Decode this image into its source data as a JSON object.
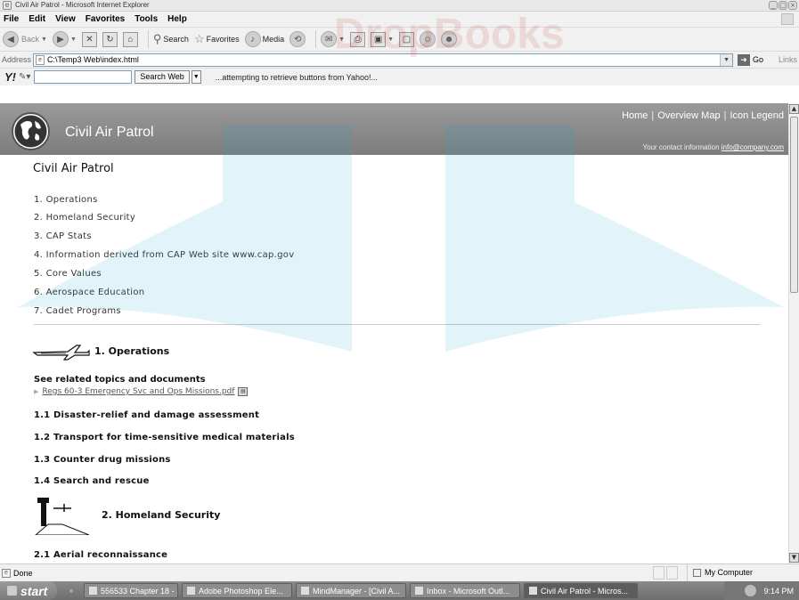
{
  "browser": {
    "window_title": "Civil Air Patrol - Microsoft Internet Explorer",
    "menu": [
      "File",
      "Edit",
      "View",
      "Favorites",
      "Tools",
      "Help"
    ],
    "toolbar": {
      "back": "Back",
      "search": "Search",
      "favorites": "Favorites",
      "media": "Media"
    },
    "address_label": "Address",
    "address_value": "C:\\Temp3 Web\\index.html",
    "go_label": "Go",
    "links_label": "Links",
    "yahoo": {
      "search_button": "Search Web",
      "message": "...attempting to retrieve buttons from Yahoo!..."
    },
    "status": {
      "text": "Done",
      "zone": "My Computer"
    }
  },
  "site": {
    "name": "Civil Air Patrol",
    "top_links": [
      "Home",
      "Overview Map",
      "Icon Legend"
    ],
    "link_separator": "|",
    "contact_label": "Your contact information",
    "contact_email": "info@company.com"
  },
  "page": {
    "title": "Civil Air Patrol",
    "toc": [
      "1. Operations",
      "2. Homeland Security",
      "3. CAP Stats",
      "4. Information derived from CAP Web site www.cap.gov",
      "5. Core Values",
      "6. Aerospace Education",
      "7. Cadet Programs"
    ],
    "section1": {
      "heading": "1. Operations",
      "related_heading": "See related topics and documents",
      "related_link": "Regs 60-3 Emergency Svc and Ops Missions.pdf",
      "subsections": [
        "1.1 Disaster-relief and damage assessment",
        "1.2 Transport for time-sensitive medical materials",
        "1.3 Counter drug missions",
        "1.4 Search and rescue"
      ]
    },
    "section2": {
      "heading": "2. Homeland Security",
      "subsections": [
        "2.1 Aerial reconnaissance"
      ]
    }
  },
  "taskbar": {
    "start": "start",
    "tasks": [
      "556533 Chapter 18 - ...",
      "Adobe Photoshop Ele...",
      "MindManager - [Civil A...",
      "Inbox - Microsoft Outl...",
      "Civil Air Patrol - Micros..."
    ],
    "clock": "9:14 PM"
  },
  "watermark_text": "DropBooks"
}
